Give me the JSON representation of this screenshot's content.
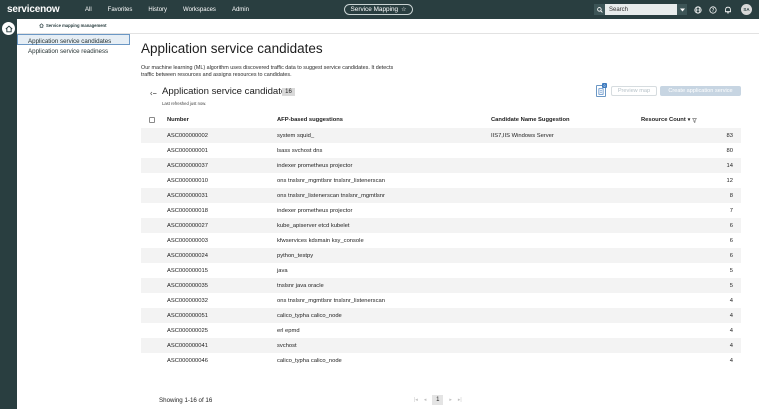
{
  "topnav": {
    "logo": "servicenow",
    "items": [
      "All",
      "Favorites",
      "History",
      "Workspaces",
      "Admin"
    ],
    "context_pill": "Service Mapping",
    "search_placeholder": "Search",
    "avatar_initials": "SA"
  },
  "subnav": {
    "breadcrumb": "Service mapping management",
    "items": [
      {
        "label": "Application service candidates",
        "active": true
      },
      {
        "label": "Application service readiness",
        "active": false
      }
    ]
  },
  "page": {
    "title": "Application service candidates",
    "description": "Our machine learning (ML) algorithm uses discovered traffic data to suggest service candidates. It detects traffic between resources and assigns resources to candidates."
  },
  "list": {
    "title": "Application service candidates",
    "count": "16",
    "last_refreshed": "Last refreshed just now.",
    "map_badge": "0",
    "preview_button": "Preview map",
    "create_button": "Create application service"
  },
  "table": {
    "headers": {
      "number": "Number",
      "afp": "AFP-based suggestions",
      "candidate": "Candidate Name Suggestion",
      "resource_count": "Resource Count"
    },
    "rows": [
      {
        "number": "ASC000000002",
        "afp": "system squid_",
        "candidate": "IIS7,IIS Windows Server",
        "count": "83"
      },
      {
        "number": "ASC000000001",
        "afp": "lsass svchost dns",
        "candidate": "",
        "count": "80"
      },
      {
        "number": "ASC000000037",
        "afp": "indexer prometheus projector",
        "candidate": "",
        "count": "14"
      },
      {
        "number": "ASC000000010",
        "afp": "ons tnslsnr_mgmtlsnr tnslsnr_listenerscan",
        "candidate": "",
        "count": "12"
      },
      {
        "number": "ASC000000031",
        "afp": "ons tnslsnr_listenerscan tnslsnr_mgmtlsnr",
        "candidate": "",
        "count": "8"
      },
      {
        "number": "ASC000000018",
        "afp": "indexer prometheus projector",
        "candidate": "",
        "count": "7"
      },
      {
        "number": "ASC000000027",
        "afp": "kube_apiserver etcd kubelet",
        "candidate": "",
        "count": "6"
      },
      {
        "number": "ASC000000003",
        "afp": "kfwservices kdsmain ksy_console",
        "candidate": "",
        "count": "6"
      },
      {
        "number": "ASC000000024",
        "afp": "python_testpy",
        "candidate": "",
        "count": "6"
      },
      {
        "number": "ASC000000015",
        "afp": "java",
        "candidate": "",
        "count": "5"
      },
      {
        "number": "ASC000000035",
        "afp": "tnslsnr java oracle",
        "candidate": "",
        "count": "5"
      },
      {
        "number": "ASC000000032",
        "afp": "ons tnslsnr_mgmtlsnr tnslsnr_listenerscan",
        "candidate": "",
        "count": "4"
      },
      {
        "number": "ASC000000051",
        "afp": "calico_typha calico_node",
        "candidate": "",
        "count": "4"
      },
      {
        "number": "ASC000000025",
        "afp": "erl epmd",
        "candidate": "",
        "count": "4"
      },
      {
        "number": "ASC000000041",
        "afp": "svchost",
        "candidate": "",
        "count": "4"
      },
      {
        "number": "ASC000000046",
        "afp": "calico_typha calico_node",
        "candidate": "",
        "count": "4"
      }
    ]
  },
  "footer": {
    "showing": "Showing 1-16 of 16",
    "current_page": "1"
  }
}
